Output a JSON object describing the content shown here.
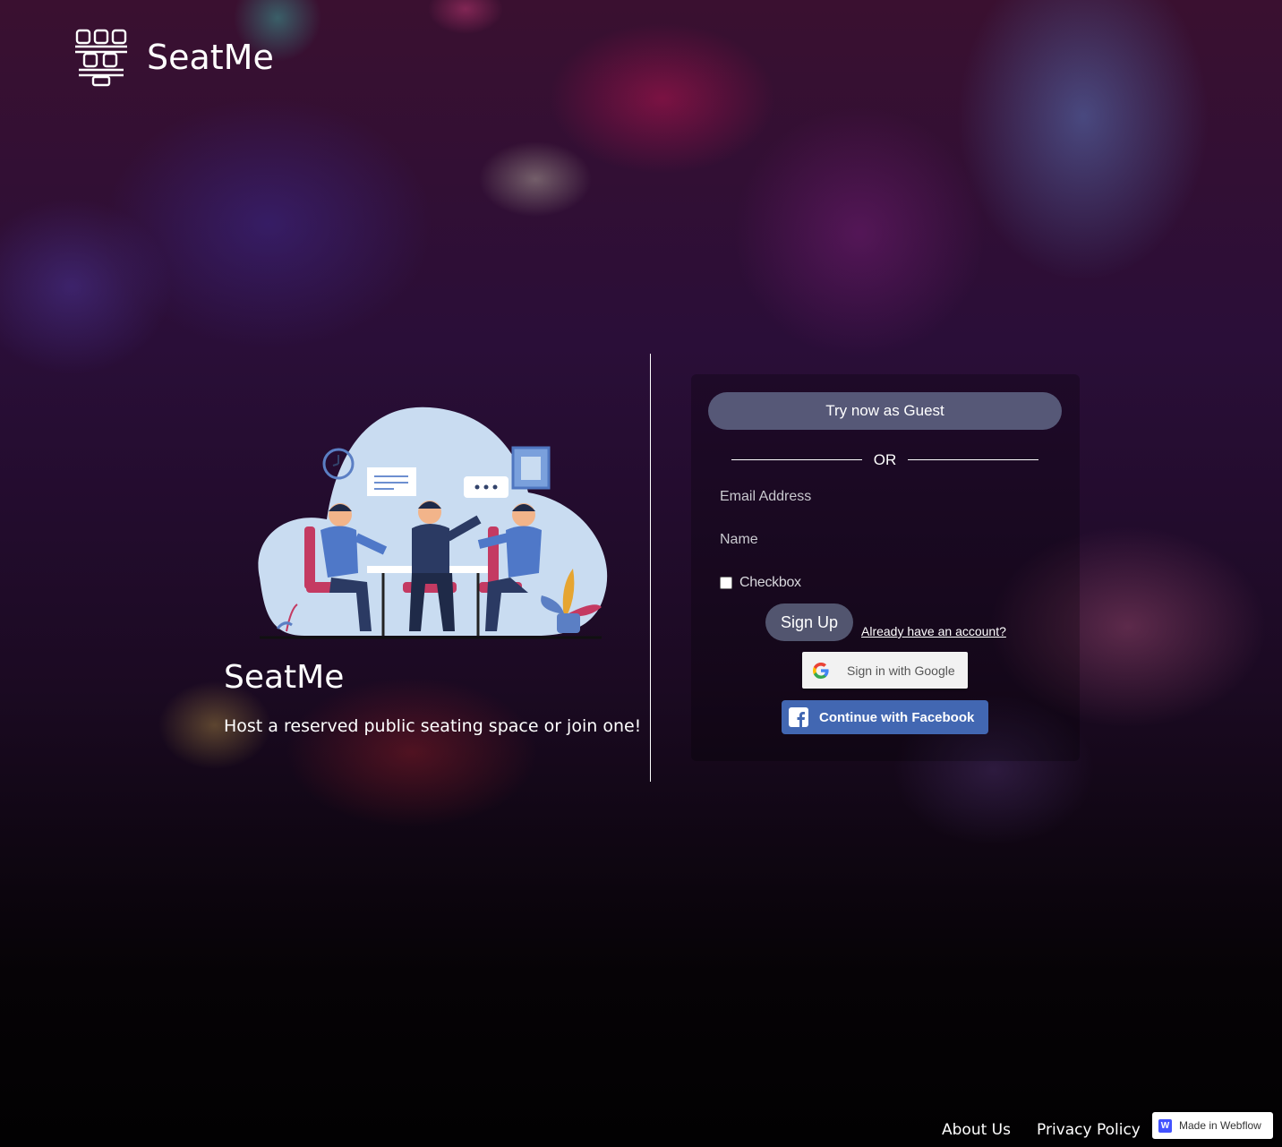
{
  "header": {
    "brand": "SeatMe",
    "logo_icon": "theater-seats-icon"
  },
  "hero": {
    "title": "SeatMe",
    "subtitle": "Host a reserved public seating space or join one!",
    "illustration": "people-meeting-illustration"
  },
  "form": {
    "guest_label": "Try now as Guest",
    "or_label": "OR",
    "email_placeholder": "Email Address",
    "email_value": "",
    "name_placeholder": "Name",
    "name_value": "",
    "checkbox_label": "Checkbox",
    "checkbox_checked": false,
    "signup_label": "Sign Up",
    "have_account_label": "Already have an account?",
    "google_label": "Sign in with Google",
    "facebook_label": "Continue with Facebook"
  },
  "footer": {
    "about_label": "About Us",
    "privacy_label": "Privacy Policy",
    "webflow_label": "Made in Webflow"
  },
  "colors": {
    "button_bg": "#565877",
    "facebook": "#4267b2",
    "webflow": "#4353ff"
  }
}
